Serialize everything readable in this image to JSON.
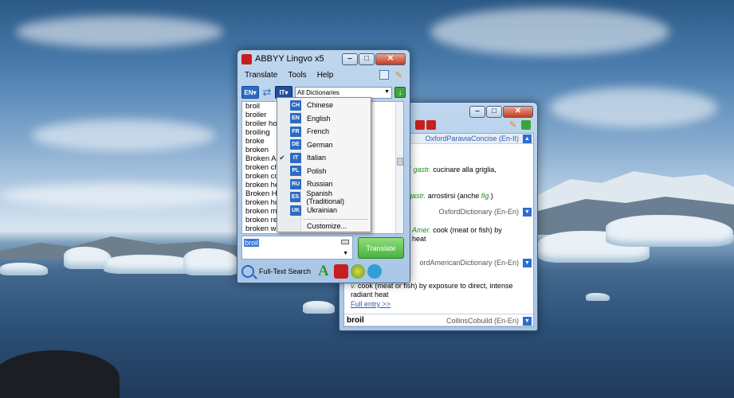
{
  "main_window": {
    "title": "ABBYY Lingvo x5",
    "menu": [
      "Translate",
      "Tools",
      "Help"
    ],
    "source_lang": "EN",
    "target_lang": "IT",
    "dictionary_select": "All Dictionaries",
    "words": [
      "broil",
      "broiler",
      "broiler hou",
      "broiling",
      "broke",
      "broken",
      "Broken Ar",
      "broken ch",
      "broken co",
      "broken he",
      "Broken Hi",
      "broken ho",
      "broken ma",
      "broken rec",
      "broken win"
    ],
    "input_value": "broil",
    "translate_label": "Translate",
    "fulltext_label": "Full-Text Search"
  },
  "lang_menu": {
    "items": [
      {
        "code": "CH",
        "name": "Chinese",
        "checked": false
      },
      {
        "code": "EN",
        "name": "English",
        "checked": false
      },
      {
        "code": "FR",
        "name": "French",
        "checked": false
      },
      {
        "code": "DE",
        "name": "German",
        "checked": false
      },
      {
        "code": "IT",
        "name": "Italian",
        "checked": true
      },
      {
        "code": "PL",
        "name": "Polish",
        "checked": false
      },
      {
        "code": "RU",
        "name": "Russian",
        "checked": false
      },
      {
        "code": "ES",
        "name": "Spanish (Traditional)",
        "checked": false
      },
      {
        "code": "UK",
        "name": "Ukrainian",
        "checked": false
      }
    ],
    "customize": "Customize..."
  },
  "card_window": {
    "dict1": "OxfordParaviaConcise (En-It)",
    "d1_line1_tag": "E gastr.",
    "d1_line1_text": "cucinare alla griglia,",
    "d1_line2_tag": "gastr.",
    "d1_line2_text": "arrostirsi (anche",
    "d1_line2_fig": "fig.",
    "d1_line2_end": ")",
    "dict2": "OxfordDictionary (En-En)",
    "d2_tag": "Amer.",
    "d2_text": "cook (meat or fish) by",
    "d2_text2": "heat",
    "dict3": "ordAmericanDictionary (En-En)",
    "d3_tag": "v.",
    "d3_text": "cook (meat or fish) by exposure to direct, intense",
    "d3_text2": "radiant heat",
    "d3_link": "Full entry >>",
    "headword": "broil",
    "dict4": "CollinsCobuild (En-En)"
  },
  "colors": {
    "accent": "#2b6cc4",
    "translate_green": "#47b43a"
  }
}
